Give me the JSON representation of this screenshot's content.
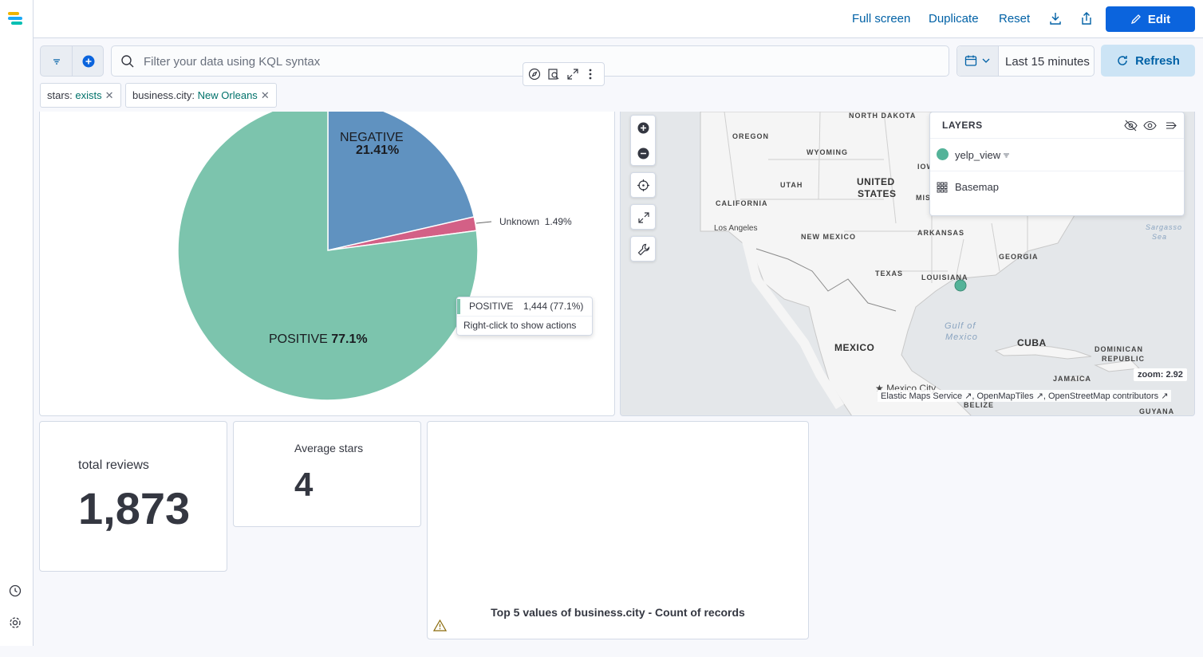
{
  "header": {
    "full_screen": "Full screen",
    "duplicate": "Duplicate",
    "reset": "Reset",
    "edit": "Edit"
  },
  "query": {
    "placeholder": "Filter your data using KQL syntax",
    "time_range": "Last 15 minutes",
    "refresh": "Refresh"
  },
  "filters": [
    {
      "key": "stars:",
      "value": "exists"
    },
    {
      "key": "business.city:",
      "value": "New Orleans"
    }
  ],
  "pie": {
    "negative_label": "NEGATIVE",
    "negative_pct": "21.41%",
    "unknown_label": "Unknown",
    "unknown_pct": "1.49%",
    "positive_label": "POSITIVE",
    "positive_pct": "77.1%"
  },
  "chart_data": {
    "type": "pie",
    "categories": [
      "POSITIVE",
      "NEGATIVE",
      "Unknown"
    ],
    "values": [
      77.1,
      21.41,
      1.49
    ],
    "colors": [
      "#7cc4ad",
      "#6092c0",
      "#d36086"
    ]
  },
  "tooltip": {
    "label": "POSITIVE",
    "value": "1,444 (77.1%)",
    "hint": "Right-click to show actions"
  },
  "map": {
    "layers_title": "LAYERS",
    "layer1": "yelp_view",
    "layer2": "Basemap",
    "zoom_label": "zoom:",
    "zoom_value": "2.92",
    "attribution": "Elastic Maps Service ↗, OpenMapTiles ↗, OpenStreetMap contributors ↗",
    "labels": {
      "north_dakota": "NORTH DAKOTA",
      "oregon": "OREGON",
      "wyoming": "WYOMING",
      "iowa": "IOW",
      "united_states_1": "UNITED",
      "united_states_2": "STATES",
      "utah": "UTAH",
      "mis": "MIS",
      "california": "CALIFORNIA",
      "los_angeles": "Los Angeles",
      "new_mexico": "NEW MEXICO",
      "arkansas": "ARKANSAS",
      "georgia": "GEORGIA",
      "texas": "TEXAS",
      "louisiana": "LOUISIANA",
      "gulf1": "Gulf of",
      "gulf2": "Mexico",
      "mexico": "MEXICO",
      "cuba": "CUBA",
      "dominican1": "DOMINICAN",
      "dominican2": "REPUBLIC",
      "jamaica": "JAMAICA",
      "mexico_city": "★ Mexico City",
      "belize": "BELIZE",
      "guyana": "GUYANA",
      "sargasso1": "Sargasso",
      "sargasso2": "Sea"
    }
  },
  "metrics": {
    "total_label": "total reviews",
    "total_value": "1,873",
    "avg_label": "Average stars",
    "avg_value": "4"
  },
  "bar_panel": {
    "title": "Top 5 values of business.city - Count of records"
  },
  "colors": {
    "accent": "#0b64dd",
    "positive": "#7cc4ad",
    "negative": "#6092c0",
    "unknown": "#d36086"
  }
}
